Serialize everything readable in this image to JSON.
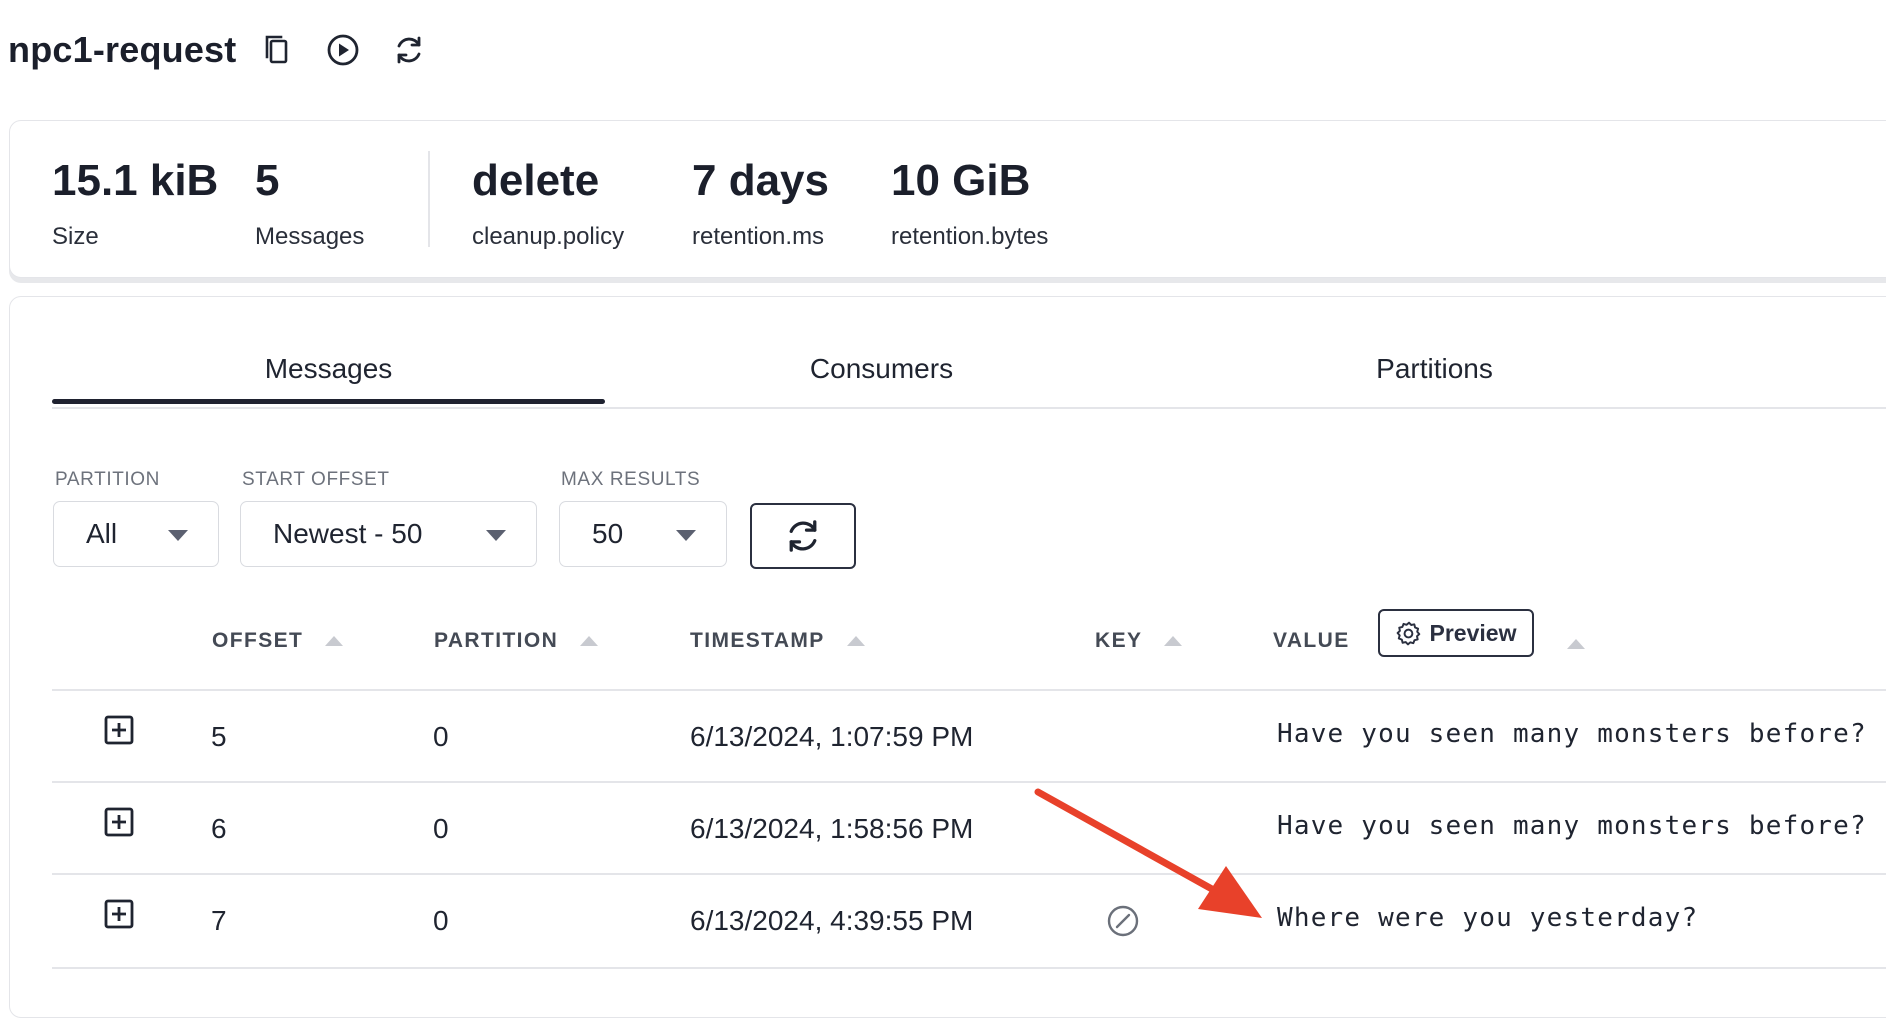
{
  "header": {
    "title": "npc1-request",
    "icons": [
      "copy-icon",
      "play-circle-icon",
      "refresh-icon"
    ]
  },
  "stats": [
    {
      "value": "15.1 kiB",
      "label": "Size"
    },
    {
      "value": "5",
      "label": "Messages"
    },
    {
      "value": "delete",
      "label": "cleanup.policy"
    },
    {
      "value": "7 days",
      "label": "retention.ms"
    },
    {
      "value": "10 GiB",
      "label": "retention.bytes"
    }
  ],
  "tabs": [
    {
      "label": "Messages",
      "active": true
    },
    {
      "label": "Consumers",
      "active": false
    },
    {
      "label": "Partitions",
      "active": false
    }
  ],
  "filters": {
    "partition": {
      "label": "PARTITION",
      "value": "All"
    },
    "start_offset": {
      "label": "START OFFSET",
      "value": "Newest - 50"
    },
    "max_results": {
      "label": "MAX RESULTS",
      "value": "50"
    }
  },
  "table": {
    "columns": [
      "OFFSET",
      "PARTITION",
      "TIMESTAMP",
      "KEY",
      "VALUE"
    ],
    "preview_label": "Preview",
    "rows": [
      {
        "offset": "5",
        "partition": "0",
        "timestamp": "6/13/2024, 1:07:59 PM",
        "key": "",
        "value": "Have you seen many monsters before?"
      },
      {
        "offset": "6",
        "partition": "0",
        "timestamp": "6/13/2024, 1:58:56 PM",
        "key": "",
        "value": "Have you seen many monsters before?"
      },
      {
        "offset": "7",
        "partition": "0",
        "timestamp": "6/13/2024, 4:39:55 PM",
        "key": "null-icon",
        "value": "Where were you yesterday?"
      }
    ]
  },
  "annotation": {
    "type": "arrow",
    "color": "#e8412a"
  }
}
